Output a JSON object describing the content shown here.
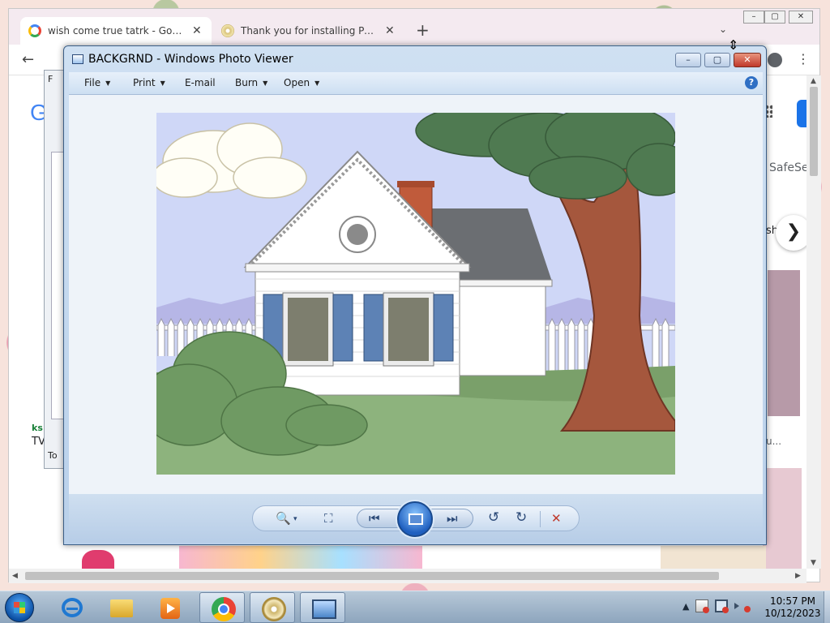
{
  "chrome": {
    "tabs": [
      {
        "label": "wish come true tatrk - Google Se",
        "close": "✕"
      },
      {
        "label": "Thank you for installing PowerISO",
        "close": "✕"
      }
    ],
    "new_tab": "+",
    "tab_search": "⌄",
    "back": "←",
    "menu": "⋮",
    "window_controls": {
      "minimize": "–",
      "restore": "▢",
      "close": "✕"
    },
    "page": {
      "safesearch": "SafeSe",
      "next_arrow": "❯",
      "left_brand": "G",
      "tv_label": "TV",
      "ks_label": "ks",
      "dialog_letters": [
        "F",
        "To"
      ],
      "right_label_sh": "sh",
      "right_label_u": "u..."
    }
  },
  "photo_viewer": {
    "title": "BACKGRND - Windows Photo Viewer",
    "window_controls": {
      "minimize": "–",
      "maximize": "▢",
      "close": "✕"
    },
    "menus": [
      {
        "label": "File",
        "has_caret": true
      },
      {
        "label": "Print",
        "has_caret": true
      },
      {
        "label": "E-mail",
        "has_caret": false
      },
      {
        "label": "Burn",
        "has_caret": true
      },
      {
        "label": "Open",
        "has_caret": true
      }
    ],
    "help": "?",
    "controls": {
      "zoom": "🔍",
      "zoom_caret": "▾",
      "actual_size": "⛶",
      "previous": "⏮",
      "next": "⏭",
      "rotate_ccw": "↺",
      "rotate_cw": "↻",
      "delete": "✕"
    },
    "colors": {
      "delete": "#c0392b",
      "sky": "#cfd7f7",
      "grass": "#7aa06a"
    }
  },
  "taskbar": {
    "pinned": [
      "internet-explorer",
      "windows-explorer",
      "windows-media-player",
      "google-chrome",
      "poweriso",
      "windows-photo-viewer"
    ],
    "tray": {
      "show_hidden": "▲"
    },
    "clock": {
      "time": "10:57 PM",
      "date": "10/12/2023"
    }
  }
}
